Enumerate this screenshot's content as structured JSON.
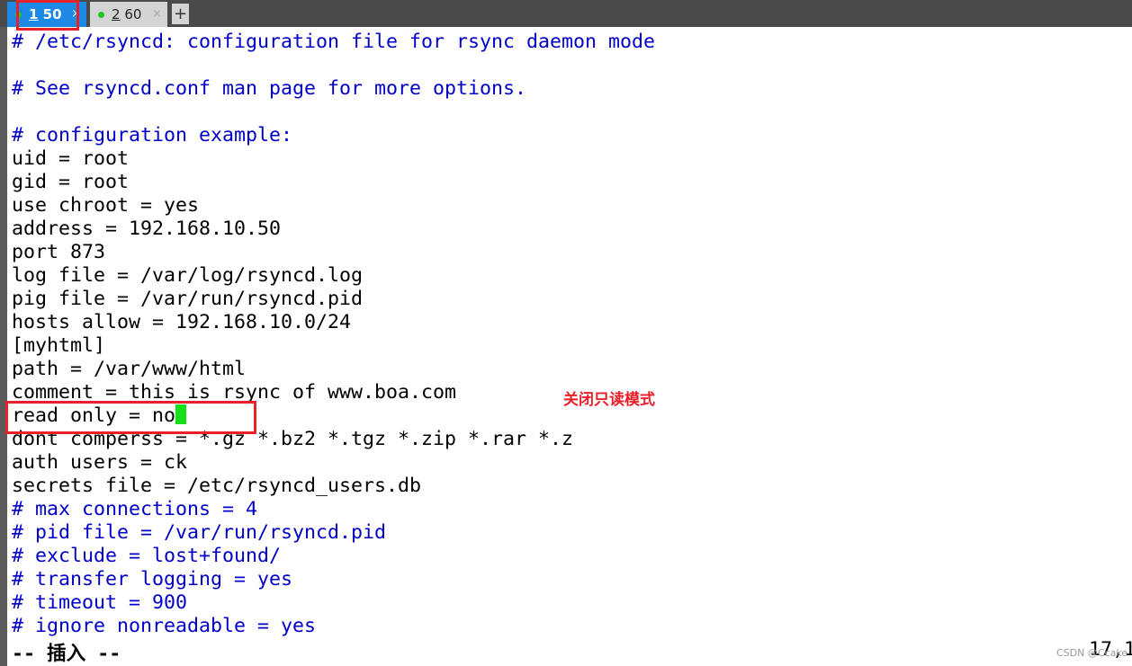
{
  "tabs": [
    {
      "num": "1",
      "label": " 50",
      "active": true
    },
    {
      "num": "2",
      "label": " 60",
      "active": false
    }
  ],
  "close_glyph": "×",
  "add_glyph": "+",
  "lines": [
    {
      "text": "# /etc/rsyncd: configuration file for rsync daemon mode",
      "comment": true
    },
    {
      "text": "",
      "comment": false
    },
    {
      "text": "# See rsyncd.conf man page for more options.",
      "comment": true
    },
    {
      "text": "",
      "comment": false
    },
    {
      "text": "# configuration example:",
      "comment": true
    },
    {
      "text": "uid = root",
      "comment": false
    },
    {
      "text": "gid = root",
      "comment": false
    },
    {
      "text": "use chroot = yes",
      "comment": false
    },
    {
      "text": "address = 192.168.10.50",
      "comment": false
    },
    {
      "text": "port 873",
      "comment": false
    },
    {
      "text": "log file = /var/log/rsyncd.log",
      "comment": false
    },
    {
      "text": "pig file = /var/run/rsyncd.pid",
      "comment": false
    },
    {
      "text": "hosts allow = 192.168.10.0/24",
      "comment": false
    },
    {
      "text": "[myhtml]",
      "comment": false
    },
    {
      "text": "path = /var/www/html",
      "comment": false
    },
    {
      "text": "comment = this is rsync of www.boa.com",
      "comment": false
    },
    {
      "text": "read only = no",
      "comment": false,
      "cursor": true
    },
    {
      "text": "dont comperss = *.gz *.bz2 *.tgz *.zip *.rar *.z",
      "comment": false
    },
    {
      "text": "auth users = ck",
      "comment": false
    },
    {
      "text": "secrets file = /etc/rsyncd_users.db",
      "comment": false
    },
    {
      "text": "# max connections = 4",
      "comment": true
    },
    {
      "text": "# pid file = /var/run/rsyncd.pid",
      "comment": true
    },
    {
      "text": "# exclude = lost+found/",
      "comment": true
    },
    {
      "text": "# transfer logging = yes",
      "comment": true
    },
    {
      "text": "# timeout = 900",
      "comment": true
    },
    {
      "text": "# ignore nonreadable = yes",
      "comment": true
    }
  ],
  "annotation": "关闭只读模式",
  "status": {
    "mode": "-- 插入 --",
    "position": "17,1"
  },
  "watermark": "CSDN @Ccake",
  "colors": {
    "comment": "#0000c8",
    "cursor": "#16e016",
    "highlight": "#e8202a",
    "active_tab": "#1e88e5"
  }
}
